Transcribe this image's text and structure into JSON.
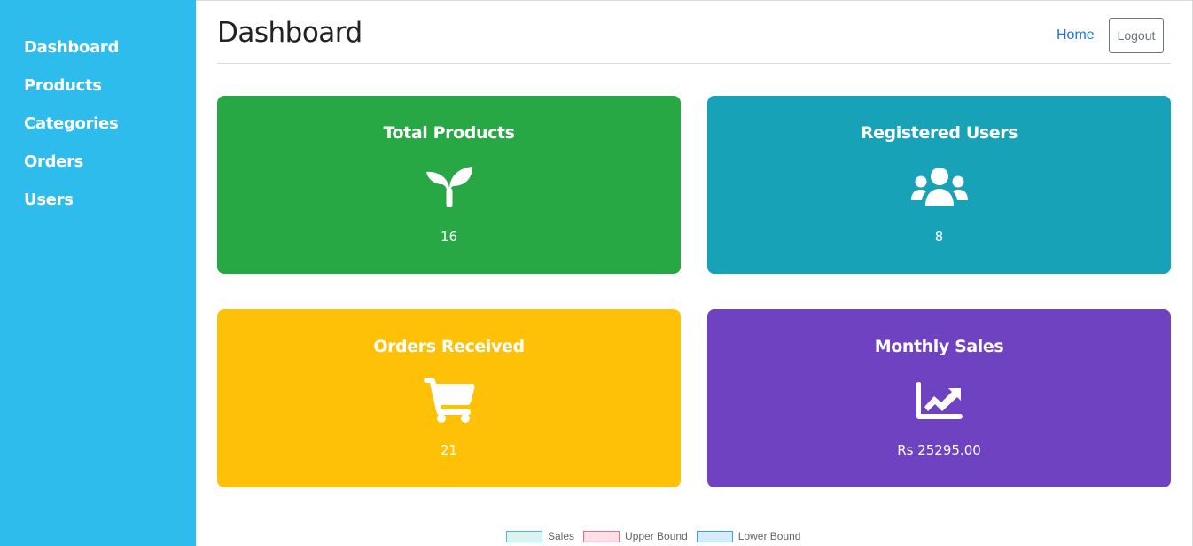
{
  "sidebar": {
    "items": [
      {
        "label": "Dashboard"
      },
      {
        "label": "Products"
      },
      {
        "label": "Categories"
      },
      {
        "label": "Orders"
      },
      {
        "label": "Users"
      }
    ]
  },
  "header": {
    "title": "Dashboard",
    "home_label": "Home",
    "logout_label": "Logout"
  },
  "cards": [
    {
      "title": "Total Products",
      "value": "16",
      "icon": "seedling-icon",
      "color": "#28a745"
    },
    {
      "title": "Registered Users",
      "value": "8",
      "icon": "users-icon",
      "color": "#17a2b8"
    },
    {
      "title": "Orders Received",
      "value": "21",
      "icon": "shopping-cart-icon",
      "color": "#ffc107"
    },
    {
      "title": "Monthly Sales",
      "value": "Rs 25295.00",
      "icon": "chart-line-icon",
      "color": "#6f42c1"
    }
  ],
  "chart_legend": [
    {
      "label": "Sales",
      "color": "#4bc0c0"
    },
    {
      "label": "Upper Bound",
      "color": "#ff6384"
    },
    {
      "label": "Lower Bound",
      "color": "#36a2eb"
    }
  ],
  "colors": {
    "sidebar": "#2ebcec",
    "link": "#1a73e8"
  }
}
